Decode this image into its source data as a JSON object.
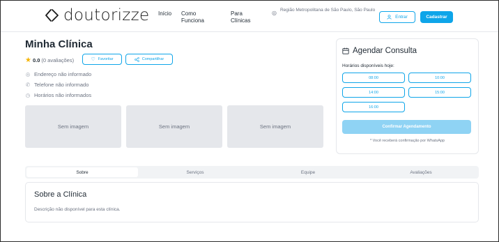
{
  "header": {
    "logo_text": "doutorizze",
    "nav": [
      {
        "label": "Início"
      },
      {
        "label": "Como Funciona"
      },
      {
        "label": "Para Clínicas"
      }
    ],
    "location": "Região Metropolitana de São Paulo, São Paulo",
    "login_label": "Entrar",
    "signup_label": "Cadastrar"
  },
  "clinic": {
    "name": "Minha Clínica",
    "rating": "0.0",
    "reviews": "(0 avaliações)",
    "favorite_label": "Favoritar",
    "share_label": "Compartilhar",
    "address": "Endereço não informado",
    "phone": "Telefone não informado",
    "hours": "Horários não informados",
    "images": [
      "Sem imagem",
      "Sem imagem",
      "Sem imagem"
    ]
  },
  "booking": {
    "title": "Agendar Consulta",
    "subtitle": "Horários disponíveis hoje:",
    "slots": [
      "08:00",
      "10:00",
      "14:00",
      "15:00",
      "16:00"
    ],
    "confirm_label": "Confirmar Agendamento",
    "note": "* Você receberá confirmação por WhatsApp"
  },
  "tabs": [
    {
      "label": "Sobre"
    },
    {
      "label": "Serviços"
    },
    {
      "label": "Equipe"
    },
    {
      "label": "Avaliações"
    }
  ],
  "about": {
    "title": "Sobre a Clínica",
    "text": "Descrição não disponível para esta clínica."
  },
  "colors": {
    "accent": "#0ea5e9",
    "confirm_disabled": "#8fd3f4",
    "star": "#f5b301"
  }
}
